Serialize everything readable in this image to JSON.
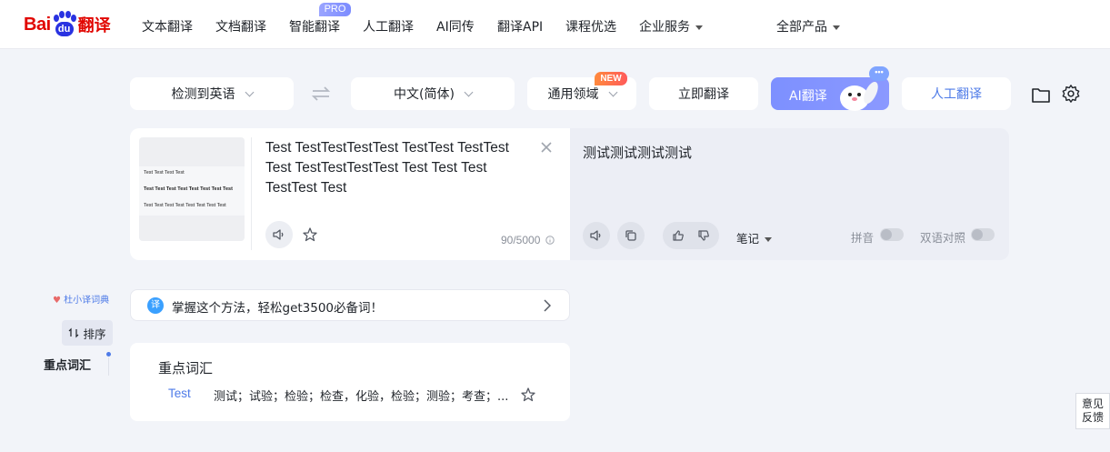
{
  "brand": {
    "logo_text_left": "Bai",
    "logo_text_mid": "du",
    "logo_text_right": "翻译"
  },
  "nav": {
    "items": [
      "文本翻译",
      "文档翻译",
      "智能翻译",
      "人工翻译",
      "AI同传",
      "翻译API",
      "课程优选",
      "企业服务"
    ],
    "pro_badge": "PRO",
    "all_products": "全部产品"
  },
  "toolbar": {
    "source_lang": "检测到英语",
    "target_lang": "中文(简体)",
    "domain": "通用领域",
    "new_badge": "NEW",
    "translate_now": "立即翻译",
    "ai_translate": "AI翻译",
    "ai_bubble": "•••",
    "human_translate": "人工翻译"
  },
  "source": {
    "text": "Test TestTestTestTest TestTest TestTest Test TestTestTestTest Test Test Test TestTest Test",
    "counter": "90/5000",
    "thumbnail_lines": [
      "Test Test Test Test",
      "Test Test Test Test Test Test Test Test",
      "Test Test Test Test Test Test Test Test"
    ]
  },
  "target": {
    "text": "测试测试测试测试",
    "notes_label": "笔记",
    "pinyin_label": "拼音",
    "bilingual_label": "双语对照"
  },
  "sidebar": {
    "dict_link": "杜小译词典",
    "sort_label": "排序",
    "active_item": "重点词汇"
  },
  "banner": {
    "icon_char": "译",
    "text": "掌握这个方法，轻松get3500必备词！"
  },
  "vocab": {
    "title": "重点词汇",
    "entries": [
      {
        "word": "Test",
        "definition": "测试；试验；检验；检查，化验，检验；测验；考查；..."
      }
    ]
  },
  "feedback": {
    "line1": "意见",
    "line2": "反馈"
  }
}
